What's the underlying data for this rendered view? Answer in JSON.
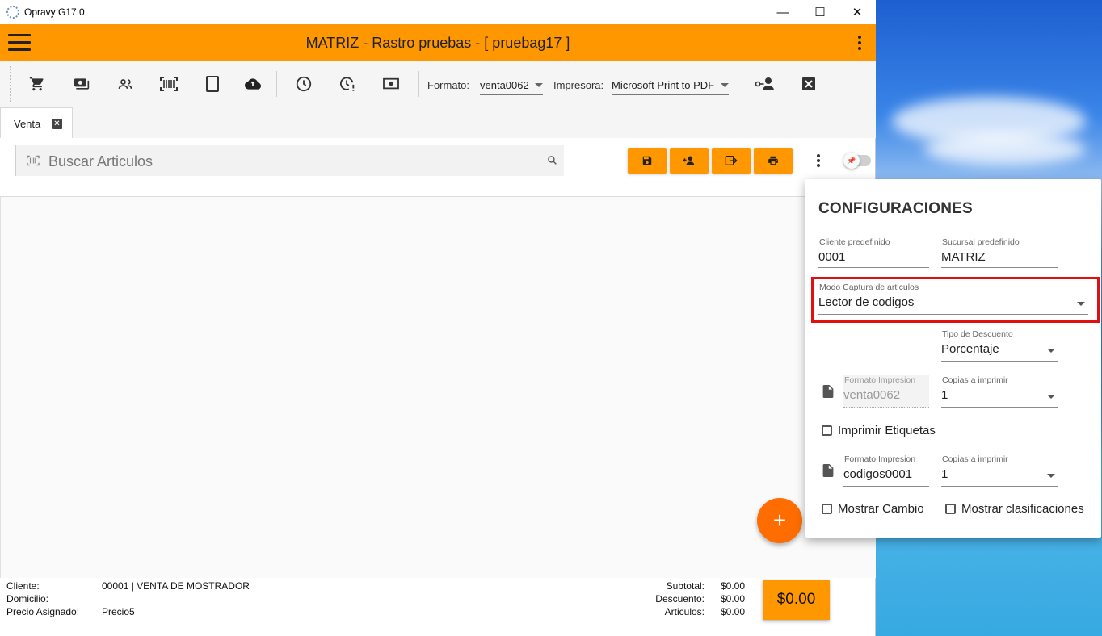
{
  "window": {
    "title": "Opravy G17.0",
    "minimize": "—",
    "maximize": "☐",
    "close": "✕"
  },
  "appbar": {
    "title": "MATRIZ - Rastro pruebas - [ pruebag17 ]"
  },
  "toolbar": {
    "formato_label": "Formato:",
    "formato_value": "venta0062",
    "impresora_label": "Impresora:",
    "impresora_value": "Microsoft Print to PDF"
  },
  "tabs": [
    {
      "label": "Venta",
      "close": "✕"
    }
  ],
  "search": {
    "placeholder": "Buscar Articulos"
  },
  "fab_label": "+",
  "footer": {
    "cliente_label": "Cliente:",
    "cliente_value": "00001 | VENTA DE MOSTRADOR",
    "domicilio_label": "Domicilio:",
    "domicilio_value": "",
    "precio_label": "Precio Asignado:",
    "precio_value": "Precio5",
    "subtotal_label": "Subtotal:",
    "subtotal_value": "$0.00",
    "descuento_label": "Descuento:",
    "descuento_value": "$0.00",
    "articulos_label": "Articulos:",
    "articulos_value": "$0.00",
    "total": "$0.00"
  },
  "config": {
    "title": "CONFIGURACIONES",
    "cliente_label": "Cliente predefinido",
    "cliente_value": "0001",
    "sucursal_label": "Sucursal predefinido",
    "sucursal_value": "MATRIZ",
    "modo_label": "Modo Captura de articulos",
    "modo_value": "Lector de codigos",
    "descuento_label": "Tipo de Descuento",
    "descuento_value": "Porcentaje",
    "formato1_label": "Formato Impresion",
    "formato1_value": "venta0062",
    "copias1_label": "Copias a imprimir",
    "copias1_value": "1",
    "etiquetas_label": "Imprimir Etiquetas",
    "formato2_label": "Formato Impresion",
    "formato2_value": "codigos0001",
    "copias2_label": "Copias a imprimir",
    "copias2_value": "1",
    "cambio_label": "Mostrar Cambio",
    "clasificaciones_label": "Mostrar clasificaciones"
  },
  "colors": {
    "accent": "#ff9800",
    "fab": "#ff6d00",
    "highlight": "#e01010"
  }
}
